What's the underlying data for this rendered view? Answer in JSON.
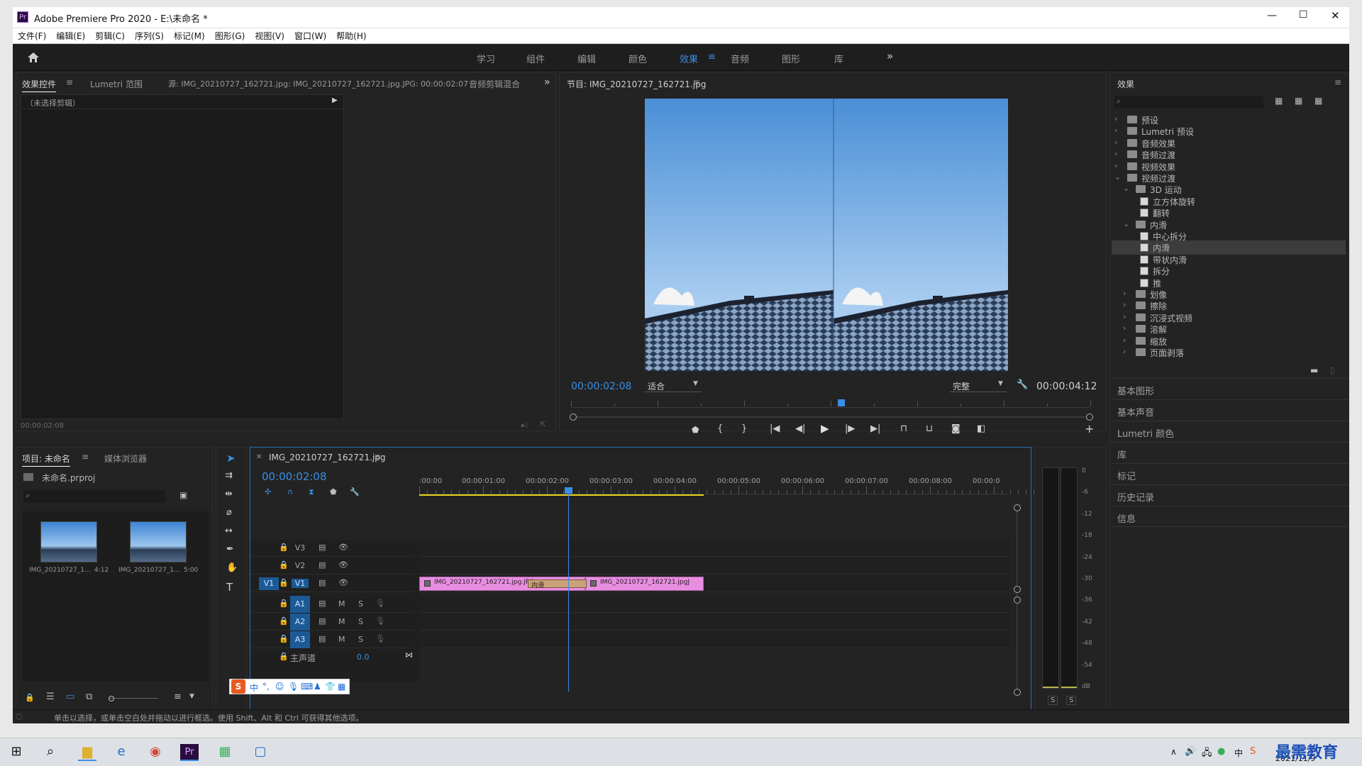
{
  "window": {
    "app_icon": "Pr",
    "title": "Adobe Premiere Pro 2020 - E:\\未命名 *",
    "controls": [
      "—",
      "☐",
      "✕"
    ]
  },
  "menu": [
    "文件(F)",
    "编辑(E)",
    "剪辑(C)",
    "序列(S)",
    "标记(M)",
    "图形(G)",
    "视图(V)",
    "窗口(W)",
    "帮助(H)"
  ],
  "workspace": {
    "home_icon": "home-icon",
    "tabs": [
      "学习",
      "组件",
      "编辑",
      "颜色",
      "效果",
      "音频",
      "图形",
      "库"
    ],
    "active": "效果",
    "more": "»"
  },
  "source_panel": {
    "tabs": [
      "效果控件",
      "Lumetri 范围",
      "源: IMG_20210727_162721.jpg: IMG_20210727_162721.jpg.JPG: 00:00:02:07",
      "音频剪辑混合"
    ],
    "no_clip": "（未选择剪辑）",
    "timecode": "00:00:02:08"
  },
  "program_monitor": {
    "title": "节目: IMG_20210727_162721.jpg",
    "current_time": "00:00:02:08",
    "zoom": "适合",
    "quality": "完整",
    "duration": "00:00:04:12",
    "playhead_fraction": 0.52
  },
  "effects_panel": {
    "title": "效果",
    "search_placeholder": "",
    "items": [
      {
        "label": "预设",
        "level": 0,
        "type": "folder",
        "open": false,
        "badge": true
      },
      {
        "label": "Lumetri 预设",
        "level": 0,
        "type": "folder",
        "open": false,
        "badge": true
      },
      {
        "label": "音频效果",
        "level": 0,
        "type": "folder",
        "open": false
      },
      {
        "label": "音频过渡",
        "level": 0,
        "type": "folder",
        "open": false
      },
      {
        "label": "视频效果",
        "level": 0,
        "type": "folder",
        "open": false
      },
      {
        "label": "视频过渡",
        "level": 0,
        "type": "folder",
        "open": true
      },
      {
        "label": "3D 运动",
        "level": 1,
        "type": "folder",
        "open": true
      },
      {
        "label": "立方体旋转",
        "level": 2,
        "type": "effect"
      },
      {
        "label": "翻转",
        "level": 2,
        "type": "effect"
      },
      {
        "label": "内滑",
        "level": 1,
        "type": "folder",
        "open": true
      },
      {
        "label": "中心拆分",
        "level": 2,
        "type": "effect"
      },
      {
        "label": "内滑",
        "level": 2,
        "type": "effect",
        "selected": true
      },
      {
        "label": "带状内滑",
        "level": 2,
        "type": "effect"
      },
      {
        "label": "拆分",
        "level": 2,
        "type": "effect"
      },
      {
        "label": "推",
        "level": 2,
        "type": "effect"
      },
      {
        "label": "划像",
        "level": 1,
        "type": "folder",
        "open": false
      },
      {
        "label": "擦除",
        "level": 1,
        "type": "folder",
        "open": false
      },
      {
        "label": "沉浸式视频",
        "level": 1,
        "type": "folder",
        "open": false
      },
      {
        "label": "溶解",
        "level": 1,
        "type": "folder",
        "open": false
      },
      {
        "label": "缩放",
        "level": 1,
        "type": "folder",
        "open": false
      },
      {
        "label": "页面剥落",
        "level": 1,
        "type": "folder",
        "open": false
      }
    ],
    "side_panels": [
      "基本图形",
      "基本声音",
      "Lumetri 颜色",
      "库",
      "标记",
      "历史记录",
      "信息"
    ]
  },
  "project_panel": {
    "tabs": [
      "项目: 未命名",
      "媒体浏览器"
    ],
    "file": "未命名.prproj",
    "search_placeholder": "",
    "thumbs": [
      {
        "name": "IMG_20210727_1...",
        "duration": "4:12"
      },
      {
        "name": "IMG_20210727_1...",
        "duration": "5:00"
      }
    ]
  },
  "timeline": {
    "tab": "IMG_20210727_162721.jpg",
    "current_time": "00:00:02:08",
    "ruler": [
      ":00:00",
      "00:00:01:00",
      "00:00:02:00",
      "00:00:03:00",
      "00:00:04:00",
      "00:00:05:00",
      "00:00:06:00",
      "00:00:07:00",
      "00:00:08:00",
      "00:00:0"
    ],
    "video_tracks": [
      "V3",
      "V2",
      "V1"
    ],
    "audio_tracks": [
      "A1",
      "A2",
      "A3"
    ],
    "source_patch": "V1",
    "master": "主声道",
    "master_value": "0.0",
    "clips": [
      {
        "name": "IMG_20210727_162721.jpg.JPG",
        "start": 0,
        "end": 2.6
      },
      {
        "name": "IMG_20210727_162721.jpgJ",
        "start": 2.6,
        "end": 4.45
      }
    ],
    "transition": "内滑",
    "playhead_seconds": 2.33,
    "mute_label": "M",
    "solo_label": "S"
  },
  "meter": {
    "scale": [
      "0",
      "-6",
      "-12",
      "-18",
      "-24",
      "-30",
      "-36",
      "-42",
      "-48",
      "-54",
      "dB"
    ],
    "solo": [
      "S",
      "S"
    ]
  },
  "status_bar": "单击以选择，或单击空白处并拖动以进行框选。使用 Shift、Alt 和 Ctrl 可获得其他选项。",
  "ime_bar": {
    "label": "中"
  },
  "taskbar": {
    "date": "2021/11/9",
    "watermark": "最需教育",
    "tray_lang": "中"
  },
  "colors": {
    "accent": "#3a8ee6",
    "clip": "#e88ee0",
    "transition": "#c9a27a",
    "workarea": "#e6d21e",
    "selected_row": "#3c3c3c"
  }
}
